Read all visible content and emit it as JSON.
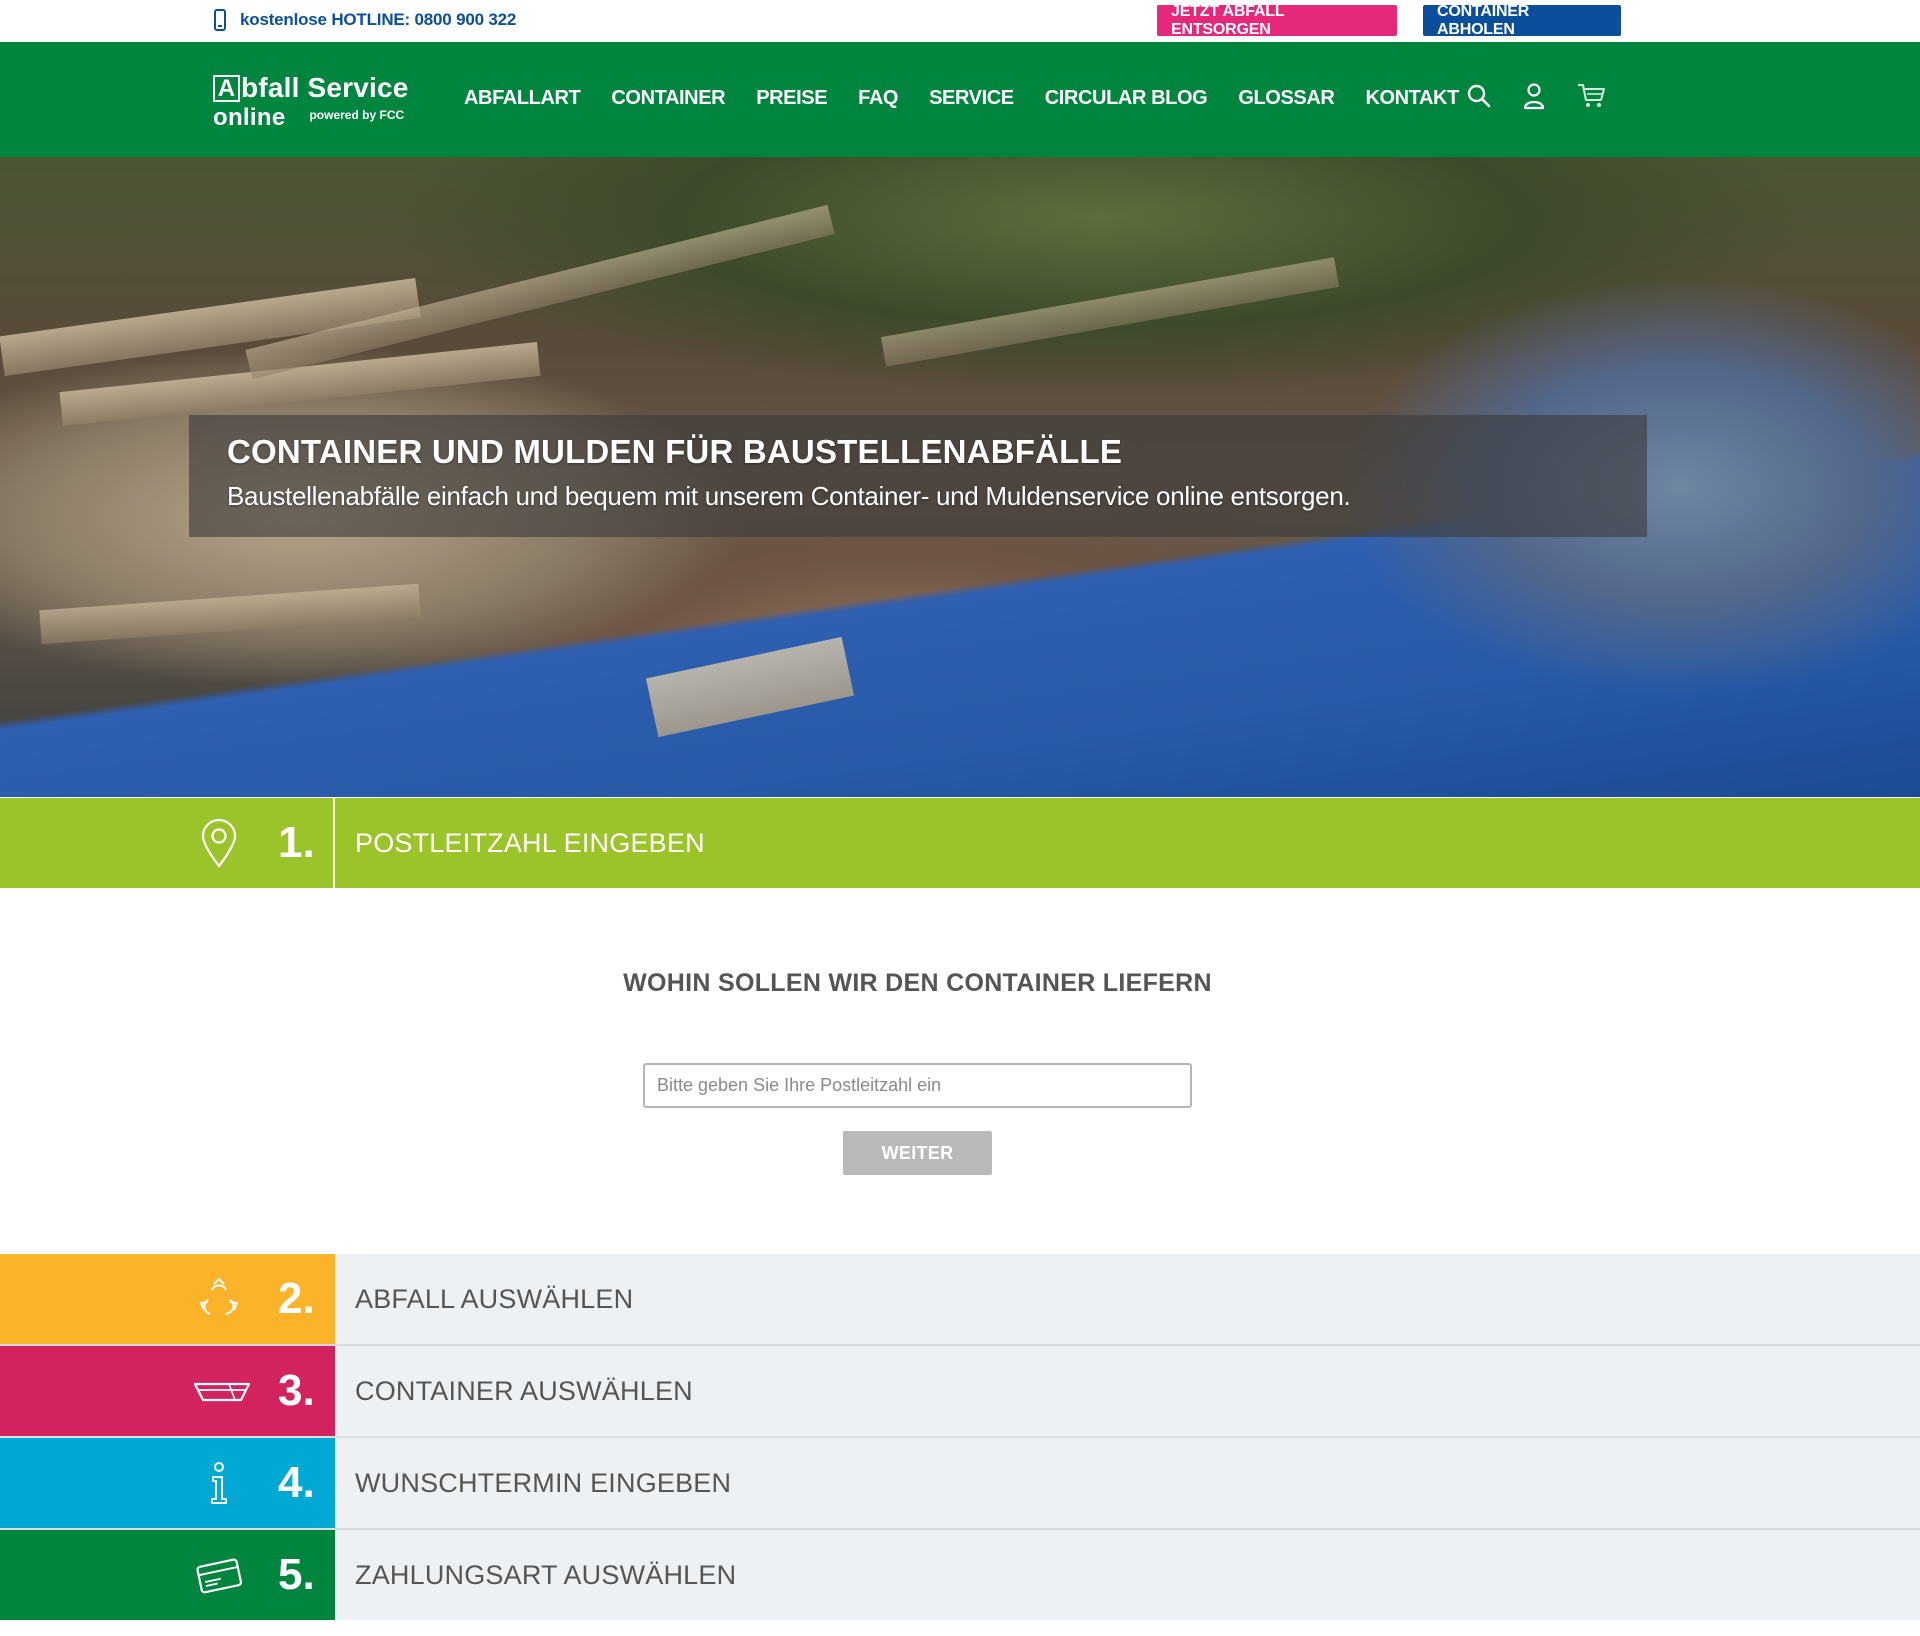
{
  "topbar": {
    "hotline": "kostenlose HOTLINE: 0800 900 322",
    "btn_dispose": "JETZT ABFALL ENTSORGEN",
    "btn_pickup": "CONTAINER ABHOLEN"
  },
  "brand": {
    "name_rest": "bfall Service",
    "name_letter": "A",
    "online": "online",
    "powered": "powered by FCC"
  },
  "nav": {
    "items": [
      {
        "label": "ABFALLART"
      },
      {
        "label": "CONTAINER"
      },
      {
        "label": "PREISE"
      },
      {
        "label": "FAQ"
      },
      {
        "label": "SERVICE"
      },
      {
        "label": "CIRCULAR BLOG"
      },
      {
        "label": "GLOSSAR"
      },
      {
        "label": "KONTAKT"
      }
    ],
    "icons": [
      "search-icon",
      "user-icon",
      "cart-icon"
    ]
  },
  "hero": {
    "title": "CONTAINER UND MULDEN FÜR BAUSTELLENABFÄLLE",
    "subtitle": "Baustellenabfälle einfach und bequem mit unserem Container- und Muldenservice online entsorgen."
  },
  "steps": [
    {
      "number": "1.",
      "label": "POSTLEITZAHL EINGEBEN",
      "color": "#9bc32a",
      "icon": "location-pin-icon"
    },
    {
      "number": "2.",
      "label": "ABFALL AUSWÄHLEN",
      "color": "#fbb42a",
      "icon": "recycle-icon"
    },
    {
      "number": "3.",
      "label": "CONTAINER AUSWÄHLEN",
      "color": "#d3235f",
      "icon": "container-icon"
    },
    {
      "number": "4.",
      "label": "WUNSCHTERMIN EINGEBEN",
      "color": "#00a9d4",
      "icon": "info-icon"
    },
    {
      "number": "5.",
      "label": "ZAHLUNGSART AUSWÄHLEN",
      "color": "#00853f",
      "icon": "credit-card-icon"
    }
  ],
  "form": {
    "title": "WOHIN SOLLEN WIR DEN CONTAINER LIEFERN",
    "zip_placeholder": "Bitte geben Sie Ihre Postleitzahl ein",
    "zip_value": "",
    "submit_label": "WEITER"
  },
  "colors": {
    "brand_green": "#00853f",
    "accent_pink": "#e6287a",
    "accent_blue": "#0b4f9c"
  }
}
